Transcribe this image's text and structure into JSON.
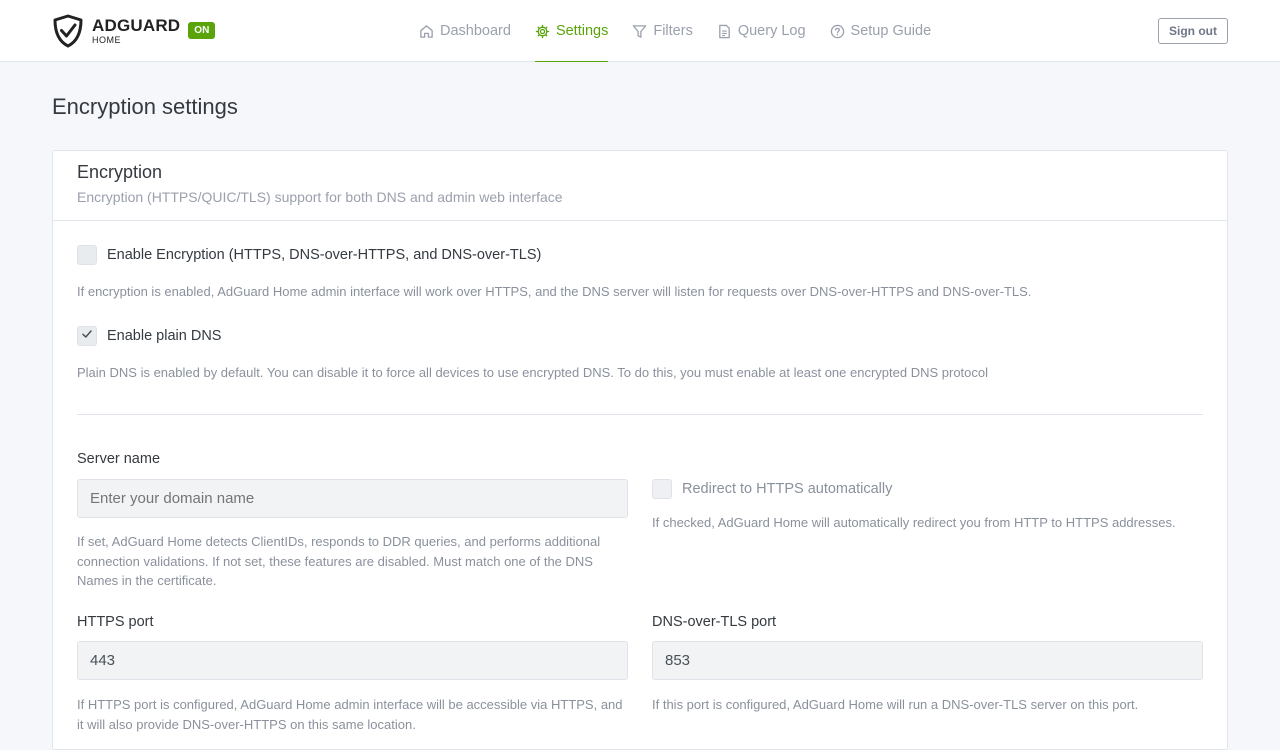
{
  "brand": {
    "title": "ADGUARD",
    "subtitle": "HOME",
    "status_badge": "ON",
    "accent_color": "#5aa30a"
  },
  "nav": {
    "items": [
      {
        "label": "Dashboard",
        "icon": "home-icon",
        "active": false
      },
      {
        "label": "Settings",
        "icon": "gear-icon",
        "active": true
      },
      {
        "label": "Filters",
        "icon": "filter-icon",
        "active": false
      },
      {
        "label": "Query Log",
        "icon": "document-icon",
        "active": false
      },
      {
        "label": "Setup Guide",
        "icon": "help-circle-icon",
        "active": false
      }
    ],
    "sign_out_label": "Sign out"
  },
  "page": {
    "title": "Encryption settings"
  },
  "card": {
    "title": "Encryption",
    "subtitle": "Encryption (HTTPS/QUIC/TLS) support for both DNS and admin web interface"
  },
  "form": {
    "enable_encryption": {
      "label": "Enable Encryption (HTTPS, DNS-over-HTTPS, and DNS-over-TLS)",
      "checked": false,
      "help": "If encryption is enabled, AdGuard Home admin interface will work over HTTPS, and the DNS server will listen for requests over DNS-over-HTTPS and DNS-over-TLS."
    },
    "enable_plain_dns": {
      "label": "Enable plain DNS",
      "checked": true,
      "help": "Plain DNS is enabled by default. You can disable it to force all devices to use encrypted DNS. To do this, you must enable at least one encrypted DNS protocol"
    },
    "server_name": {
      "label": "Server name",
      "value": "",
      "placeholder": "Enter your domain name",
      "help": "If set, AdGuard Home detects ClientIDs, responds to DDR queries, and performs additional connection validations. If not set, these features are disabled. Must match one of the DNS Names in the certificate."
    },
    "redirect_https": {
      "label": "Redirect to HTTPS automatically",
      "checked": false,
      "help": "If checked, AdGuard Home will automatically redirect you from HTTP to HTTPS addresses."
    },
    "https_port": {
      "label": "HTTPS port",
      "value": "443",
      "help": "If HTTPS port is configured, AdGuard Home admin interface will be accessible via HTTPS, and it will also provide DNS-over-HTTPS on this same location."
    },
    "dot_port": {
      "label": "DNS-over-TLS port",
      "value": "853",
      "help": "If this port is configured, AdGuard Home will run a DNS-over-TLS server on this port."
    }
  }
}
